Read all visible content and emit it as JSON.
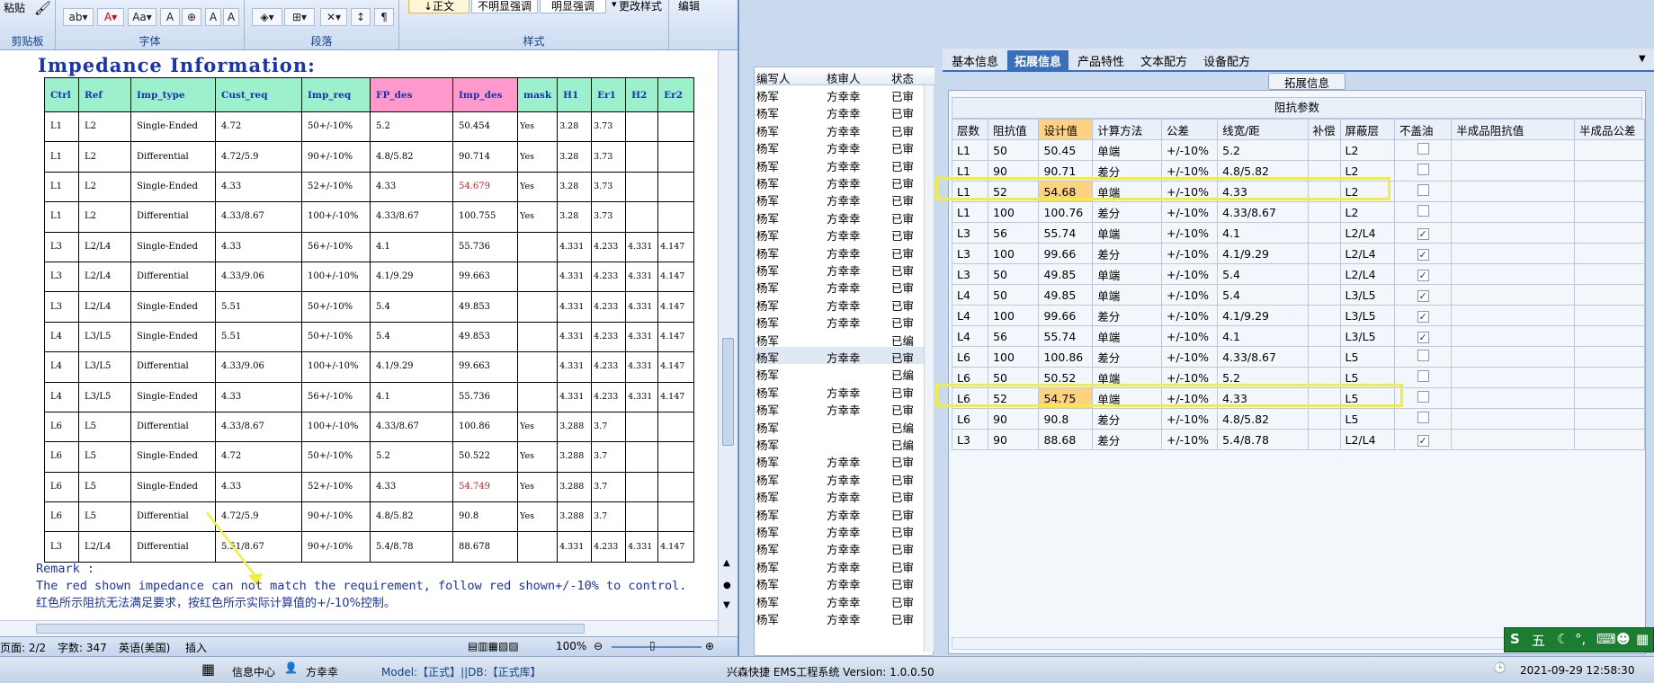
{
  "word": {
    "ribbon": {
      "paste_label": "粘贴",
      "group_clipboard": "剪贴板",
      "group_font": "字体",
      "group_paragraph": "段落",
      "group_styles": "样式",
      "group_edit": "编辑",
      "style_normal": "↓正文",
      "style_subtle": "不明显强调",
      "style_emphasis": "明显强调",
      "change_styles": "更改样式"
    },
    "doc_title": "Impedance Information:",
    "table": {
      "headers": [
        "Ctrl",
        "Ref",
        "Imp_type",
        "Cust_req",
        "Imp_req",
        "FP_des",
        "Imp_des",
        "mask",
        "H1",
        "Er1",
        "H2",
        "Er2"
      ],
      "rows": [
        [
          "L1",
          "L2",
          "Single-Ended",
          "4.72",
          "50+/-10%",
          "5.2",
          "50.454",
          "Yes",
          "3.28",
          "3.73",
          "",
          ""
        ],
        [
          "L1",
          "L2",
          "Differential",
          "4.72/5.9",
          "90+/-10%",
          "4.8/5.82",
          "90.714",
          "Yes",
          "3.28",
          "3.73",
          "",
          ""
        ],
        [
          "L1",
          "L2",
          "Single-Ended",
          "4.33",
          "52+/-10%",
          "4.33",
          "54.679",
          "Yes",
          "3.28",
          "3.73",
          "",
          ""
        ],
        [
          "L1",
          "L2",
          "Differential",
          "4.33/8.67",
          "100+/-10%",
          "4.33/8.67",
          "100.755",
          "Yes",
          "3.28",
          "3.73",
          "",
          ""
        ],
        [
          "L3",
          "L2/L4",
          "Single-Ended",
          "4.33",
          "56+/-10%",
          "4.1",
          "55.736",
          "",
          "4.331",
          "4.233",
          "4.331",
          "4.147"
        ],
        [
          "L3",
          "L2/L4",
          "Differential",
          "4.33/9.06",
          "100+/-10%",
          "4.1/9.29",
          "99.663",
          "",
          "4.331",
          "4.233",
          "4.331",
          "4.147"
        ],
        [
          "L3",
          "L2/L4",
          "Single-Ended",
          "5.51",
          "50+/-10%",
          "5.4",
          "49.853",
          "",
          "4.331",
          "4.233",
          "4.331",
          "4.147"
        ],
        [
          "L4",
          "L3/L5",
          "Single-Ended",
          "5.51",
          "50+/-10%",
          "5.4",
          "49.853",
          "",
          "4.331",
          "4.233",
          "4.331",
          "4.147"
        ],
        [
          "L4",
          "L3/L5",
          "Differential",
          "4.33/9.06",
          "100+/-10%",
          "4.1/9.29",
          "99.663",
          "",
          "4.331",
          "4.233",
          "4.331",
          "4.147"
        ],
        [
          "L4",
          "L3/L5",
          "Single-Ended",
          "4.33",
          "56+/-10%",
          "4.1",
          "55.736",
          "",
          "4.331",
          "4.233",
          "4.331",
          "4.147"
        ],
        [
          "L6",
          "L5",
          "Differential",
          "4.33/8.67",
          "100+/-10%",
          "4.33/8.67",
          "100.86",
          "Yes",
          "3.288",
          "3.7",
          "",
          ""
        ],
        [
          "L6",
          "L5",
          "Single-Ended",
          "4.72",
          "50+/-10%",
          "5.2",
          "50.522",
          "Yes",
          "3.288",
          "3.7",
          "",
          ""
        ],
        [
          "L6",
          "L5",
          "Single-Ended",
          "4.33",
          "52+/-10%",
          "4.33",
          "54.749",
          "Yes",
          "3.288",
          "3.7",
          "",
          ""
        ],
        [
          "L6",
          "L5",
          "Differential",
          "4.72/5.9",
          "90+/-10%",
          "4.8/5.82",
          "90.8",
          "Yes",
          "3.288",
          "3.7",
          "",
          ""
        ],
        [
          "L3",
          "L2/L4",
          "Differential",
          "5.51/8.67",
          "90+/-10%",
          "5.4/8.78",
          "88.678",
          "",
          "4.331",
          "4.233",
          "4.331",
          "4.147"
        ]
      ]
    },
    "remark_label": "Remark :",
    "remark_en": "The red shown impedance can not match the requirement, follow red shown+/-10% to control.",
    "remark_cn": "红色所示阻抗无法满足要求，按红色所示实际计算值的+/-10%控制。",
    "status": {
      "page": "页面: 2/2",
      "words": "字数: 347",
      "lang": "英语(美国)",
      "insert": "插入",
      "zoom": "100%"
    }
  },
  "middle_list": {
    "headers": [
      "编写人",
      "核审人",
      "状态"
    ],
    "rows": [
      [
        "杨军",
        "方幸幸",
        "已审"
      ],
      [
        "杨军",
        "方幸幸",
        "已审"
      ],
      [
        "杨军",
        "方幸幸",
        "已审"
      ],
      [
        "杨军",
        "方幸幸",
        "已审"
      ],
      [
        "杨军",
        "方幸幸",
        "已审"
      ],
      [
        "杨军",
        "方幸幸",
        "已审"
      ],
      [
        "杨军",
        "方幸幸",
        "已审"
      ],
      [
        "杨军",
        "方幸幸",
        "已审"
      ],
      [
        "杨军",
        "方幸幸",
        "已审"
      ],
      [
        "杨军",
        "方幸幸",
        "已审"
      ],
      [
        "杨军",
        "方幸幸",
        "已审"
      ],
      [
        "杨军",
        "方幸幸",
        "已审"
      ],
      [
        "杨军",
        "方幸幸",
        "已审"
      ],
      [
        "杨军",
        "方幸幸",
        "已审"
      ],
      [
        "杨军",
        "",
        "已编"
      ],
      [
        "杨军",
        "方幸幸",
        "已审"
      ],
      [
        "杨军",
        "",
        "已编"
      ],
      [
        "杨军",
        "方幸幸",
        "已审"
      ],
      [
        "杨军",
        "方幸幸",
        "已审"
      ],
      [
        "杨军",
        "",
        "已编"
      ],
      [
        "杨军",
        "",
        "已编"
      ],
      [
        "杨军",
        "方幸幸",
        "已审"
      ],
      [
        "杨军",
        "方幸幸",
        "已审"
      ],
      [
        "杨军",
        "方幸幸",
        "已审"
      ],
      [
        "杨军",
        "方幸幸",
        "已审"
      ],
      [
        "杨军",
        "方幸幸",
        "已审"
      ],
      [
        "杨军",
        "方幸幸",
        "已审"
      ],
      [
        "杨军",
        "方幸幸",
        "已审"
      ],
      [
        "杨军",
        "方幸幸",
        "已审"
      ],
      [
        "杨军",
        "方幸幸",
        "已审"
      ],
      [
        "杨军",
        "方幸幸",
        "已审"
      ]
    ]
  },
  "right_panel": {
    "tabs": [
      "基本信息",
      "拓展信息",
      "产品特性",
      "文本配方",
      "设备配方"
    ],
    "group_title": "拓展信息",
    "table_title": "阻抗参数",
    "headers": [
      "层数",
      "阻抗值",
      "设计值",
      "计算方法",
      "公差",
      "线宽/距",
      "补偿",
      "屏蔽层",
      "不盖油",
      "半成品阻抗值",
      "半成品公差"
    ],
    "rows": [
      [
        "L1",
        "50",
        "50.45",
        "单端",
        "+/-10%",
        "5.2",
        "",
        "L2",
        false
      ],
      [
        "L1",
        "90",
        "90.71",
        "差分",
        "+/-10%",
        "4.8/5.82",
        "",
        "L2",
        false
      ],
      [
        "L1",
        "52",
        "54.68",
        "单端",
        "+/-10%",
        "4.33",
        "",
        "L2",
        false
      ],
      [
        "L1",
        "100",
        "100.76",
        "差分",
        "+/-10%",
        "4.33/8.67",
        "",
        "L2",
        false
      ],
      [
        "L3",
        "56",
        "55.74",
        "单端",
        "+/-10%",
        "4.1",
        "",
        "L2/L4",
        true
      ],
      [
        "L3",
        "100",
        "99.66",
        "差分",
        "+/-10%",
        "4.1/9.29",
        "",
        "L2/L4",
        true
      ],
      [
        "L3",
        "50",
        "49.85",
        "单端",
        "+/-10%",
        "5.4",
        "",
        "L2/L4",
        true
      ],
      [
        "L4",
        "50",
        "49.85",
        "单端",
        "+/-10%",
        "5.4",
        "",
        "L3/L5",
        true
      ],
      [
        "L4",
        "100",
        "99.66",
        "差分",
        "+/-10%",
        "4.1/9.29",
        "",
        "L3/L5",
        true
      ],
      [
        "L4",
        "56",
        "55.74",
        "单端",
        "+/-10%",
        "4.1",
        "",
        "L3/L5",
        true
      ],
      [
        "L6",
        "100",
        "100.86",
        "差分",
        "+/-10%",
        "4.33/8.67",
        "",
        "L5",
        false
      ],
      [
        "L6",
        "50",
        "50.52",
        "单端",
        "+/-10%",
        "5.2",
        "",
        "L5",
        false
      ],
      [
        "L6",
        "52",
        "54.75",
        "单端",
        "+/-10%",
        "4.33",
        "",
        "L5",
        false
      ],
      [
        "L6",
        "90",
        "90.8",
        "差分",
        "+/-10%",
        "4.8/5.82",
        "",
        "L5",
        false
      ],
      [
        "L3",
        "90",
        "88.68",
        "差分",
        "+/-10%",
        "5.4/8.78",
        "",
        "L2/L4",
        true
      ]
    ]
  },
  "bottom_bar": {
    "info_center": "信息中心",
    "user": "方幸幸",
    "model": "Model:【正式】||DB:【正式库】",
    "system": "兴森快捷 EMS工程系统 Version: 1.0.0.50",
    "datetime": "2021-09-29 12:58:30"
  },
  "ime": {
    "label": "五"
  },
  "colors": {
    "accent": "#3a6fbe",
    "highlight": "#ffd27f",
    "yellow_box": "#f1ef3c",
    "title_blue": "#1a33b3",
    "red_value": "#d12020"
  }
}
